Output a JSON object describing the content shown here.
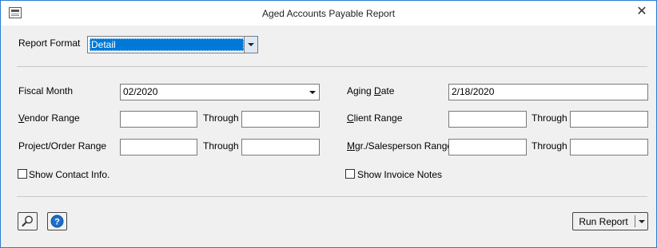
{
  "window": {
    "title": "Aged Accounts Payable Report",
    "close_glyph": "✕",
    "app_icon": "report-window-icon"
  },
  "report_format": {
    "label": "Report Format",
    "selected": "Detail"
  },
  "fiscal_month": {
    "label": "Fiscal Month",
    "value": "02/2020"
  },
  "aging_date": {
    "label_pre": "Aging ",
    "label_accel": "D",
    "label_post": "ate",
    "value": "2/18/2020"
  },
  "vendor_range": {
    "label_accel": "V",
    "label_post": "endor Range",
    "from": "",
    "through_label": "Through",
    "to": ""
  },
  "client_range": {
    "label_accel": "C",
    "label_post": "lient Range",
    "from": "",
    "through_label": "Through",
    "to": ""
  },
  "project_range": {
    "label": "Project/Order Range",
    "from": "",
    "through_label": "Through",
    "to": ""
  },
  "mgr_range": {
    "label_accel": "M",
    "label_post": "gr./Salesperson Range",
    "from": "",
    "through_label": "Through",
    "to": ""
  },
  "show_contact": {
    "label": "Show Contact Info.",
    "checked": false
  },
  "show_invoice_notes": {
    "label": "Show Invoice Notes",
    "checked": false
  },
  "footer": {
    "search_icon": "magnifier-icon",
    "help_icon": "help-icon",
    "help_glyph": "?",
    "run_label": "Run Report"
  },
  "colors": {
    "accent": "#0078d7",
    "window_border": "#2b7bd3",
    "background": "#f0f0f0"
  }
}
